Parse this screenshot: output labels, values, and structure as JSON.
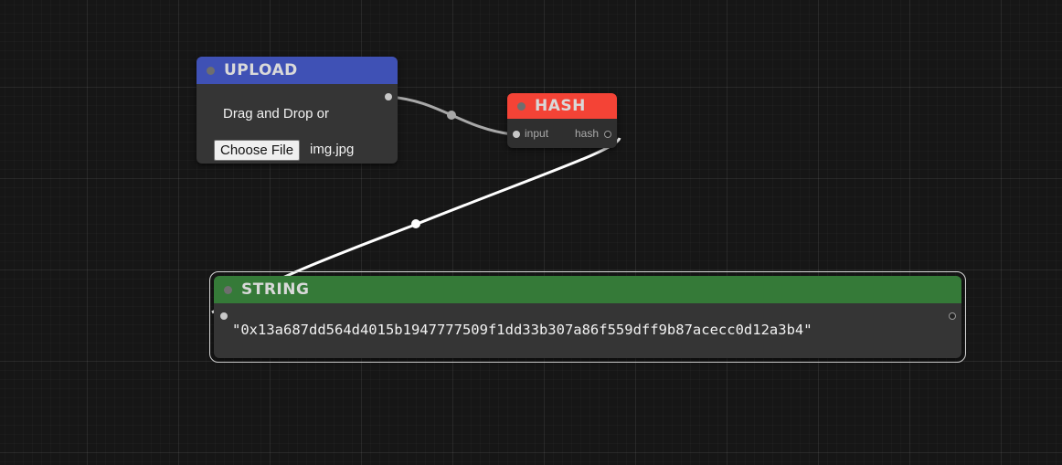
{
  "nodes": {
    "upload": {
      "title": "UPLOAD",
      "color": "#3f51b5",
      "drag_text": "Drag and Drop or",
      "choose_file_label": "Choose File",
      "file_name": "img.jpg"
    },
    "hash": {
      "title": "HASH",
      "color": "#f44336",
      "input_label": "input",
      "output_label": "hash"
    },
    "string": {
      "title": "STRING",
      "color": "#357a38",
      "value": "\"0x13a687dd564d4015b1947777509f1dd33b307a86f559dff9b87acecc0d12a3b4\""
    }
  },
  "links": [
    {
      "from": "upload.output",
      "to": "hash.input",
      "color": "#a8a8a8"
    },
    {
      "from": "hash.hash",
      "to": "string.input",
      "color": "#ffffff"
    }
  ]
}
